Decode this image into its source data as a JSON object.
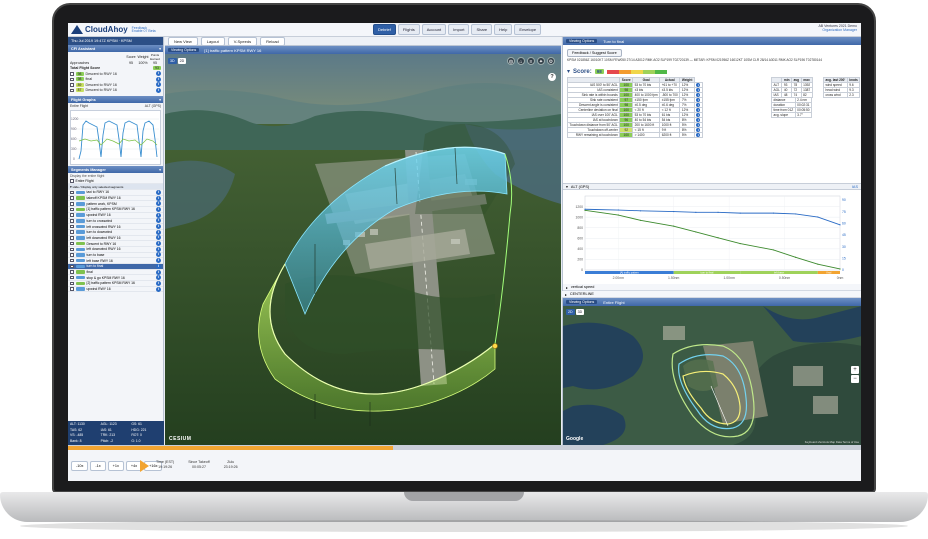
{
  "app": {
    "logo": "CloudAhoy",
    "logo_sub1": "Feedback",
    "logo_sub2": "Enable 07 Beta",
    "user_line1": "AB Ventures 2021 Demo",
    "user_line2": "Organization Manager",
    "logout": "Logout"
  },
  "nav": {
    "debrief": "Debrief",
    "flights": "Flights",
    "account": "Account",
    "import": "Import",
    "share": "Share",
    "help": "Help",
    "envelope": "Envelope"
  },
  "left": {
    "flight_date": "Thu Jul 2019  19:47Z  KPSM · KPSM",
    "cfi_head": "CFI Assistant",
    "score_cols": [
      "Score",
      "Weight",
      "Points Earned"
    ],
    "approaches_label": "Approaches",
    "approaches_score": "95",
    "approaches_weight": "100%",
    "approaches_points": "95",
    "total_label": "Total Flight Score",
    "total_score": "93",
    "items": [
      {
        "score": "98",
        "label": "Descent to RWY 16",
        "grade": "g"
      },
      {
        "score": "98",
        "label": "final",
        "grade": "g"
      },
      {
        "score": "89",
        "label": "Descent to RWY 16",
        "grade": "y"
      },
      {
        "score": "87",
        "label": "Descent to RWY 16",
        "grade": "y"
      }
    ],
    "graphs_head": "Flight Graphs",
    "graph_select": "Entire Flight",
    "graph_hint": "ALT (GPS)",
    "segments_head": "Segments Manager",
    "display_text": "Display the entire flight",
    "entire_flight": "Entire Flight",
    "hide_text": "Hide / Display only selected segments",
    "segments": [
      {
        "label": "taxi to RWY 16",
        "tag": "blue"
      },
      {
        "label": "takeoff KPSM RWY 16",
        "tag": "green"
      },
      {
        "label": "pattern work, KPSM",
        "tag": "blue"
      },
      {
        "label": "[1] traffic pattern KPSM RWY 16",
        "tag": "green"
      },
      {
        "label": "upwind RWY 16",
        "tag": "blue"
      },
      {
        "label": "turn to crosswind",
        "tag": "blue"
      },
      {
        "label": "left crosswind RWY 16",
        "tag": "blue"
      },
      {
        "label": "turn to downwind",
        "tag": "blue"
      },
      {
        "label": "left downwind RWY 16",
        "tag": "blue"
      },
      {
        "label": "Descent to RWY 16",
        "tag": "green"
      },
      {
        "label": "left downwind RWY 16",
        "tag": "blue"
      },
      {
        "label": "turn to base",
        "tag": "blue"
      },
      {
        "label": "left base RWY 16",
        "tag": "blue"
      },
      {
        "label": "turn to final",
        "tag": "blue",
        "hl": true
      },
      {
        "label": "final",
        "tag": "green"
      },
      {
        "label": "stop & go KPSM RWY 16",
        "tag": "blue"
      },
      {
        "label": "[2] traffic pattern KPSM RWY 16",
        "tag": "green"
      },
      {
        "label": "upwind RWY 16",
        "tag": "blue"
      }
    ],
    "stats": [
      "ALT: 1130",
      "AGL: 1123",
      "GS: 61",
      "TAS: 62",
      "IAS: 61",
      "HDG: 221",
      "VS: -485",
      "TRK: 213",
      "ROT: 0",
      "Bank: 8",
      "Pitch: -2",
      "G: 1.0"
    ]
  },
  "view3d": {
    "toolbar": [
      "New View",
      "Layout",
      "V-Speeds",
      "Reload"
    ],
    "options_label": "Viewing Options",
    "title": "[1] traffic pattern KPSM RWY 16",
    "modes": [
      "3D",
      "2D"
    ],
    "cesium": "CESIUM"
  },
  "right": {
    "options_label": "Viewing Options",
    "title": "Turn to final",
    "feedback_btn": "Feedback / Suggest Score",
    "metar": "KPSM 021856Z 16010KT 10SM FEW050 27/14 A3012 RMK AO2 SLP199 T02720139 — METAR: KPSM 021956Z 16012KT 10SM CLR 28/14 A3011 RMK AO2 SLP196 T02780144",
    "score_label": "Score:",
    "score_value": "98",
    "grade_headers": [
      "",
      "Score",
      "Goal",
      "Actual",
      "Weight"
    ],
    "grade_rows": [
      [
        "IAS 500' to 50' AGL",
        "100",
        "53 to 70 kts",
        "+61 to +70",
        "12%",
        "g"
      ],
      [
        "IAS consistent",
        "98",
        "±3 kts",
        "±3.5 kts",
        "12%",
        "g"
      ],
      [
        "Sink rate is within bounds",
        "100",
        "400 to 1000 fpm",
        "-500 to 700",
        "12%",
        "g"
      ],
      [
        "Sink rate consistent",
        "97",
        "±150 fpm",
        "±155 fpm",
        "7%",
        "g"
      ],
      [
        "Descent angle is consistent",
        "98",
        "±0.5 deg",
        "±0.6 deg",
        "7%",
        "g"
      ],
      [
        "Centerline deviation on final",
        "100",
        "< 20 ft",
        "< 12 ft",
        "12%",
        "g"
      ],
      [
        "IAS over 100' AGL",
        "100",
        "53 to 70 kts",
        "61 kts",
        "12%",
        "g"
      ],
      [
        "IAS at touchdown",
        "96",
        "40 to 54 kts",
        "54 kts",
        "8%",
        "g"
      ],
      [
        "Touchdown distance from 50' AGL",
        "100",
        "200 to 1600 ft",
        "1000 ft",
        "5%",
        "g"
      ],
      [
        "Touchdown off-center",
        "92",
        "< 15 ft",
        "9 ft",
        "8%",
        "y"
      ],
      [
        "RWY remaining at touchdown",
        "100",
        "> 1400",
        "6200 ft",
        "5%",
        "g"
      ]
    ],
    "wind_headers": [
      "",
      "min",
      "avg",
      "max"
    ],
    "wind_rows": [
      [
        "ALT",
        "93",
        "78",
        "1392"
      ],
      [
        "AGL",
        "40",
        "72",
        "1387"
      ],
      [
        "IAS",
        "48",
        "74",
        "82"
      ]
    ],
    "dist_rows": [
      [
        "distance",
        "2.4 nm"
      ],
      [
        "duration",
        "00:02:31"
      ],
      [
        "time from 01Z",
        "00:05:50"
      ],
      [
        "avg. slope",
        "3.7°"
      ]
    ],
    "wind2_headers": [
      "avg. last 200'",
      "knots"
    ],
    "wind2_rows": [
      [
        "wind speed",
        "9.6"
      ],
      [
        "head wind",
        "9.3"
      ],
      [
        "cross wind",
        "2.3"
      ]
    ],
    "alt_label": "ALT (GPS)",
    "ias_label": "IAS",
    "collapse_rows": [
      "vertical speed",
      "GLS",
      "CENTERLINE"
    ]
  },
  "map": {
    "options_label": "Viewing Options",
    "title": "Entire Flight",
    "modes": [
      "2D",
      "3D"
    ],
    "google": "Google",
    "foot": "Keyboard shortcuts  Map Data  Terms of Use"
  },
  "playback": {
    "speeds": [
      "-10x",
      "-1x",
      "+1x",
      "+4x",
      "+16x"
    ],
    "time_label": "Time (EST)",
    "time_value": "19:19:26",
    "since_label": "Since Takeoff",
    "since_value": "00:05:27",
    "zulu_label": "Zulu",
    "zulu_value": "23:19:26",
    "progress": 0.41
  },
  "chart_data": {
    "type": "line",
    "title": "",
    "x": [
      2.3,
      2.0,
      1.8,
      1.5,
      1.3,
      1.1,
      0.9,
      0.6,
      0.4,
      0.2,
      0.0
    ],
    "x_unit": "nm",
    "xlabel": "",
    "ylim": [
      0,
      1400
    ],
    "yticks": [
      0,
      200,
      400,
      600,
      800,
      1000,
      1200
    ],
    "ylim_right": [
      0,
      95
    ],
    "yticks_right": [
      0,
      15,
      30,
      45,
      60,
      75,
      90
    ],
    "series": [
      {
        "name": "ALT (GPS)",
        "values": [
          1130,
          1040,
          940,
          830,
          720,
          610,
          500,
          380,
          240,
          110,
          20
        ]
      },
      {
        "name": "IAS",
        "values": [
          78,
          77,
          76,
          75,
          74,
          74,
          73,
          73,
          72,
          68,
          58
        ]
      }
    ],
    "x_ticks": [
      "2.00nm",
      "1.50nm",
      "1.00nm",
      "0.50nm",
      "0nm"
    ],
    "labels": [
      "[A] traffic pattern",
      "turn to final",
      "left base",
      "final"
    ],
    "grid": true
  }
}
